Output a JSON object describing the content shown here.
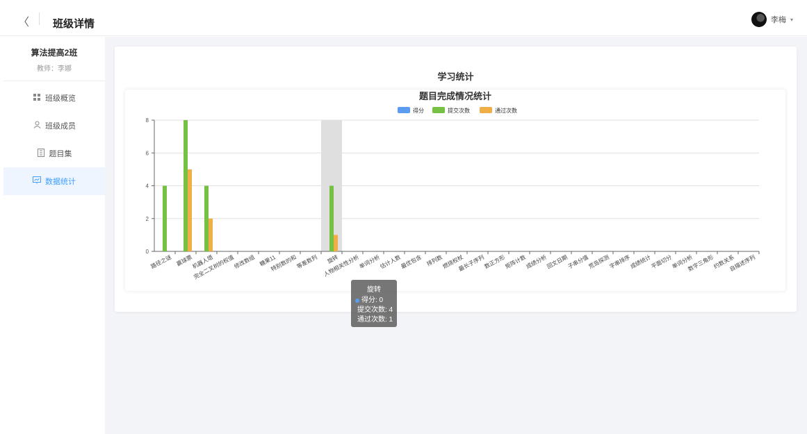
{
  "header": {
    "back_icon": "chevron-left-icon",
    "title": "班级详情",
    "user_name": "李梅",
    "caret": "▾"
  },
  "sidebar": {
    "class_name": "算法提高2班",
    "teacher": "教师：李娜",
    "items": [
      {
        "label": "班级概览",
        "icon": "grid-icon",
        "active": false
      },
      {
        "label": "班级成员",
        "icon": "user-icon",
        "active": false
      },
      {
        "label": "题目集",
        "icon": "document-icon",
        "active": false
      },
      {
        "label": "数据统计",
        "icon": "chart-board-icon",
        "active": true
      }
    ]
  },
  "main": {
    "section_title": "学习统计"
  },
  "tooltip": {
    "title": "旋转",
    "rows": [
      "得分: 0",
      "提交次数: 4",
      "通过次数: 1"
    ]
  },
  "chart_data": {
    "type": "bar",
    "title": "题目完成情况统计",
    "legend_position": "top-center",
    "grid": true,
    "ylim": [
      0,
      8
    ],
    "yticks": [
      0,
      2,
      4,
      6,
      8
    ],
    "colors": {
      "得分": "#5b9bf0",
      "提交次数": "#76c043",
      "通过次数": "#f0ae46"
    },
    "categories": [
      "路径之谜",
      "赢球票",
      "机器人塔",
      "完全二叉树的权值",
      "修改数组",
      "糖果11",
      "特别数的和",
      "等差数列",
      "旋转",
      "人物相关性分析",
      "单词分析",
      "估计人数",
      "最优包含",
      "排列数",
      "燃烧权杖",
      "最长子序列",
      "数正方形",
      "矩阵计数",
      "成绩分析",
      "回文日期",
      "子串分值",
      "荒岛探测",
      "字串排序",
      "成绩统计",
      "平面切分",
      "单词分析",
      "数字三角形",
      "约数关系",
      "自描述序列"
    ],
    "series": [
      {
        "name": "得分",
        "values": [
          0,
          0,
          0,
          0,
          0,
          0,
          0,
          0,
          0,
          0,
          0,
          0,
          0,
          0,
          0,
          0,
          0,
          0,
          0,
          0,
          0,
          0,
          0,
          0,
          0,
          0,
          0,
          0,
          0
        ]
      },
      {
        "name": "提交次数",
        "values": [
          4,
          8,
          4,
          0,
          0,
          0,
          0,
          0,
          4,
          0,
          0,
          0,
          0,
          0,
          0,
          0,
          0,
          0,
          0,
          0,
          0,
          0,
          0,
          0,
          0,
          0,
          0,
          0,
          0
        ]
      },
      {
        "name": "通过次数",
        "values": [
          0,
          5,
          2,
          0,
          0,
          0,
          0,
          0,
          1,
          0,
          0,
          0,
          0,
          0,
          0,
          0,
          0,
          0,
          0,
          0,
          0,
          0,
          0,
          0,
          0,
          0,
          0,
          0,
          0
        ]
      }
    ],
    "highlight_index": 8
  }
}
